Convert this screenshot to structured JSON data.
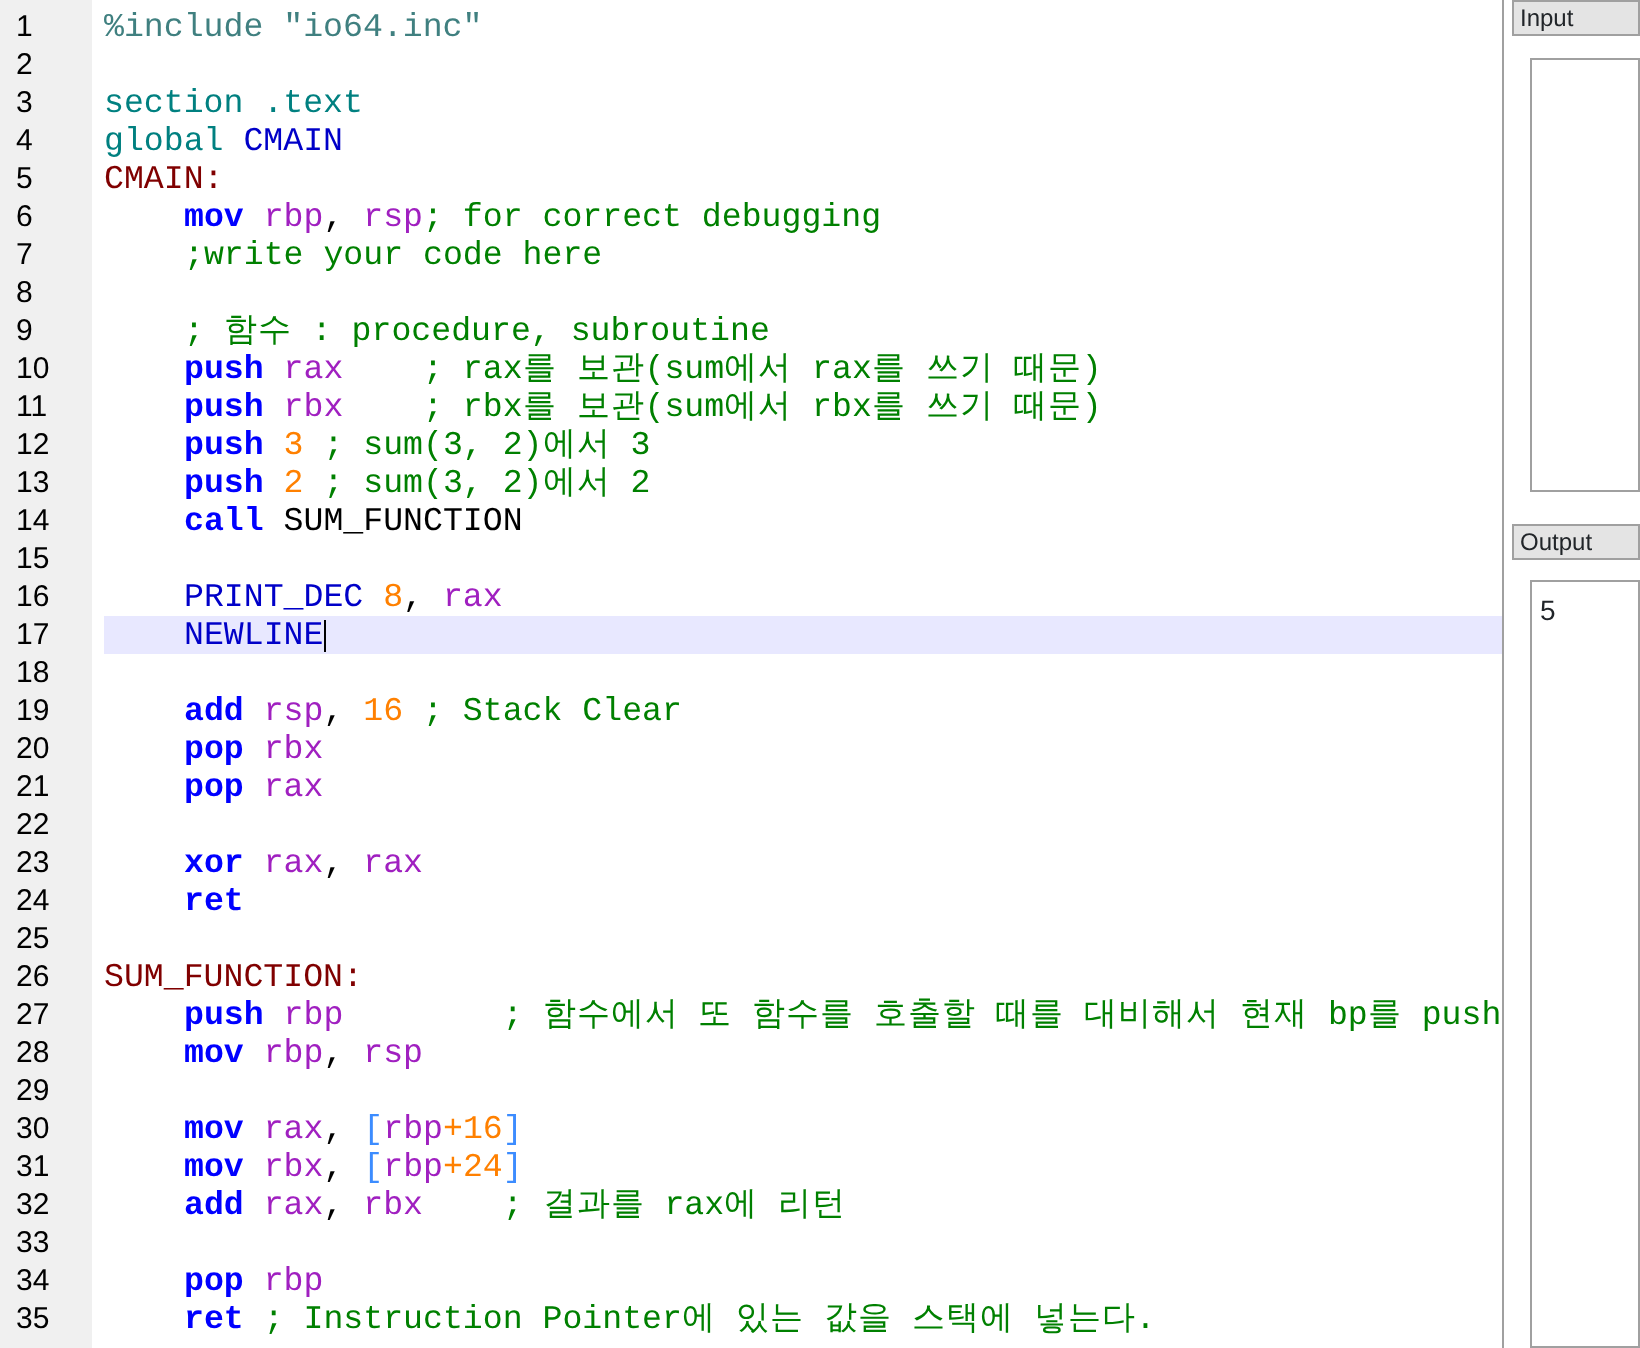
{
  "editor": {
    "lines": [
      {
        "number": "1",
        "current": false,
        "indented": false,
        "tokens": [
          {
            "kind": "preproc",
            "text": "%include \"io64.inc\""
          }
        ]
      },
      {
        "number": "2",
        "current": false
      },
      {
        "number": "3",
        "current": false,
        "indented": false,
        "tokens": [
          {
            "kind": "directive",
            "text": "section .text"
          }
        ]
      },
      {
        "number": "4",
        "current": false,
        "indented": false,
        "tokens": [
          {
            "kind": "directive",
            "text": "global"
          },
          {
            "kind": "symbol",
            "text": " CMAIN"
          }
        ]
      },
      {
        "number": "5",
        "current": false,
        "indented": false,
        "tokens": [
          {
            "kind": "label",
            "text": "CMAIN:"
          }
        ]
      },
      {
        "number": "6",
        "current": false,
        "indented": true,
        "tokens": [
          {
            "kind": "keyword",
            "text": "mov"
          },
          {
            "kind": "register",
            "text": " rbp"
          },
          {
            "kind": "plain",
            "text": ", "
          },
          {
            "kind": "register",
            "text": "rsp"
          },
          {
            "kind": "comment",
            "text": "; for correct debugging"
          }
        ]
      },
      {
        "number": "7",
        "current": false,
        "indented": true,
        "tokens": [
          {
            "kind": "comment",
            "text": ";write your code here"
          }
        ]
      },
      {
        "number": "8",
        "current": false
      },
      {
        "number": "9",
        "current": false,
        "indented": true,
        "tokens": [
          {
            "kind": "comment",
            "text": "; 함수 : procedure, subroutine"
          }
        ]
      },
      {
        "number": "10",
        "current": false,
        "indented": true,
        "tokens": [
          {
            "kind": "keyword",
            "text": "push"
          },
          {
            "kind": "register",
            "text": " rax"
          },
          {
            "kind": "comment",
            "text": "    ; rax를 보관(sum에서 rax를 쓰기 때문)"
          }
        ]
      },
      {
        "number": "11",
        "current": false,
        "indented": true,
        "tokens": [
          {
            "kind": "keyword",
            "text": "push"
          },
          {
            "kind": "register",
            "text": " rbx"
          },
          {
            "kind": "comment",
            "text": "    ; rbx를 보관(sum에서 rbx를 쓰기 때문)"
          }
        ]
      },
      {
        "number": "12",
        "current": false,
        "indented": true,
        "tokens": [
          {
            "kind": "keyword",
            "text": "push"
          },
          {
            "kind": "number",
            "text": " 3"
          },
          {
            "kind": "comment",
            "text": " ; sum(3, 2)에서 3"
          }
        ]
      },
      {
        "number": "13",
        "current": false,
        "indented": true,
        "tokens": [
          {
            "kind": "keyword",
            "text": "push"
          },
          {
            "kind": "number",
            "text": " 2"
          },
          {
            "kind": "comment",
            "text": " ; sum(3, 2)에서 2"
          }
        ]
      },
      {
        "number": "14",
        "current": false,
        "indented": true,
        "tokens": [
          {
            "kind": "keyword",
            "text": "call"
          },
          {
            "kind": "plain",
            "text": " SUM_FUNCTION"
          }
        ]
      },
      {
        "number": "15",
        "current": false
      },
      {
        "number": "16",
        "current": false,
        "indented": true,
        "tokens": [
          {
            "kind": "symbol",
            "text": "PRINT_DEC"
          },
          {
            "kind": "number",
            "text": " 8"
          },
          {
            "kind": "plain",
            "text": ", "
          },
          {
            "kind": "register",
            "text": "rax"
          }
        ]
      },
      {
        "number": "17",
        "current": true,
        "indented": true,
        "tokens": [
          {
            "kind": "symbol",
            "text": "NEWLINE"
          }
        ]
      },
      {
        "number": "18",
        "current": false
      },
      {
        "number": "19",
        "current": false,
        "indented": true,
        "tokens": [
          {
            "kind": "keyword",
            "text": "add"
          },
          {
            "kind": "register",
            "text": " rsp"
          },
          {
            "kind": "plain",
            "text": ", "
          },
          {
            "kind": "number",
            "text": "16"
          },
          {
            "kind": "comment",
            "text": " ; Stack Clear"
          }
        ]
      },
      {
        "number": "20",
        "current": false,
        "indented": true,
        "tokens": [
          {
            "kind": "keyword",
            "text": "pop"
          },
          {
            "kind": "register",
            "text": " rbx"
          }
        ]
      },
      {
        "number": "21",
        "current": false,
        "indented": true,
        "tokens": [
          {
            "kind": "keyword",
            "text": "pop"
          },
          {
            "kind": "register",
            "text": " rax"
          }
        ]
      },
      {
        "number": "22",
        "current": false
      },
      {
        "number": "23",
        "current": false,
        "indented": true,
        "tokens": [
          {
            "kind": "keyword",
            "text": "xor"
          },
          {
            "kind": "register",
            "text": " rax"
          },
          {
            "kind": "plain",
            "text": ", "
          },
          {
            "kind": "register",
            "text": "rax"
          }
        ]
      },
      {
        "number": "24",
        "current": false,
        "indented": true,
        "tokens": [
          {
            "kind": "keyword",
            "text": "ret"
          }
        ]
      },
      {
        "number": "25",
        "current": false
      },
      {
        "number": "26",
        "current": false,
        "indented": false,
        "tokens": [
          {
            "kind": "label",
            "text": "SUM_FUNCTION:"
          }
        ]
      },
      {
        "number": "27",
        "current": false,
        "indented": true,
        "tokens": [
          {
            "kind": "keyword",
            "text": "push"
          },
          {
            "kind": "register",
            "text": " rbp"
          },
          {
            "kind": "comment",
            "text": "        ; 함수에서 또 함수를 호출할 때를 대비해서 현재 bp를 push"
          }
        ]
      },
      {
        "number": "28",
        "current": false,
        "indented": true,
        "tokens": [
          {
            "kind": "keyword",
            "text": "mov"
          },
          {
            "kind": "register",
            "text": " rbp"
          },
          {
            "kind": "plain",
            "text": ", "
          },
          {
            "kind": "register",
            "text": "rsp"
          }
        ]
      },
      {
        "number": "29",
        "current": false
      },
      {
        "number": "30",
        "current": false,
        "indented": true,
        "tokens": [
          {
            "kind": "keyword",
            "text": "mov"
          },
          {
            "kind": "register",
            "text": " rax"
          },
          {
            "kind": "plain",
            "text": ", "
          },
          {
            "kind": "bracket",
            "text": "["
          },
          {
            "kind": "register",
            "text": "rbp"
          },
          {
            "kind": "number",
            "text": "+16"
          },
          {
            "kind": "bracket",
            "text": "]"
          }
        ]
      },
      {
        "number": "31",
        "current": false,
        "indented": true,
        "tokens": [
          {
            "kind": "keyword",
            "text": "mov"
          },
          {
            "kind": "register",
            "text": " rbx"
          },
          {
            "kind": "plain",
            "text": ", "
          },
          {
            "kind": "bracket",
            "text": "["
          },
          {
            "kind": "register",
            "text": "rbp"
          },
          {
            "kind": "number",
            "text": "+24"
          },
          {
            "kind": "bracket",
            "text": "]"
          }
        ]
      },
      {
        "number": "32",
        "current": false,
        "indented": true,
        "tokens": [
          {
            "kind": "keyword",
            "text": "add"
          },
          {
            "kind": "register",
            "text": " rax"
          },
          {
            "kind": "plain",
            "text": ", "
          },
          {
            "kind": "register",
            "text": "rbx"
          },
          {
            "kind": "comment",
            "text": "    ; 결과를 rax에 리턴"
          }
        ]
      },
      {
        "number": "33",
        "current": false
      },
      {
        "number": "34",
        "current": false,
        "indented": true,
        "tokens": [
          {
            "kind": "keyword",
            "text": "pop"
          },
          {
            "kind": "register",
            "text": " rbp"
          }
        ]
      },
      {
        "number": "35",
        "current": false,
        "indented": true,
        "tokens": [
          {
            "kind": "keyword",
            "text": "ret"
          },
          {
            "kind": "comment",
            "text": " ; Instruction Pointer에 있는 값을 스택에 넣는다."
          }
        ]
      }
    ]
  },
  "input_panel": {
    "title": "Input"
  },
  "output_panel": {
    "title": "Output",
    "text": "5"
  }
}
